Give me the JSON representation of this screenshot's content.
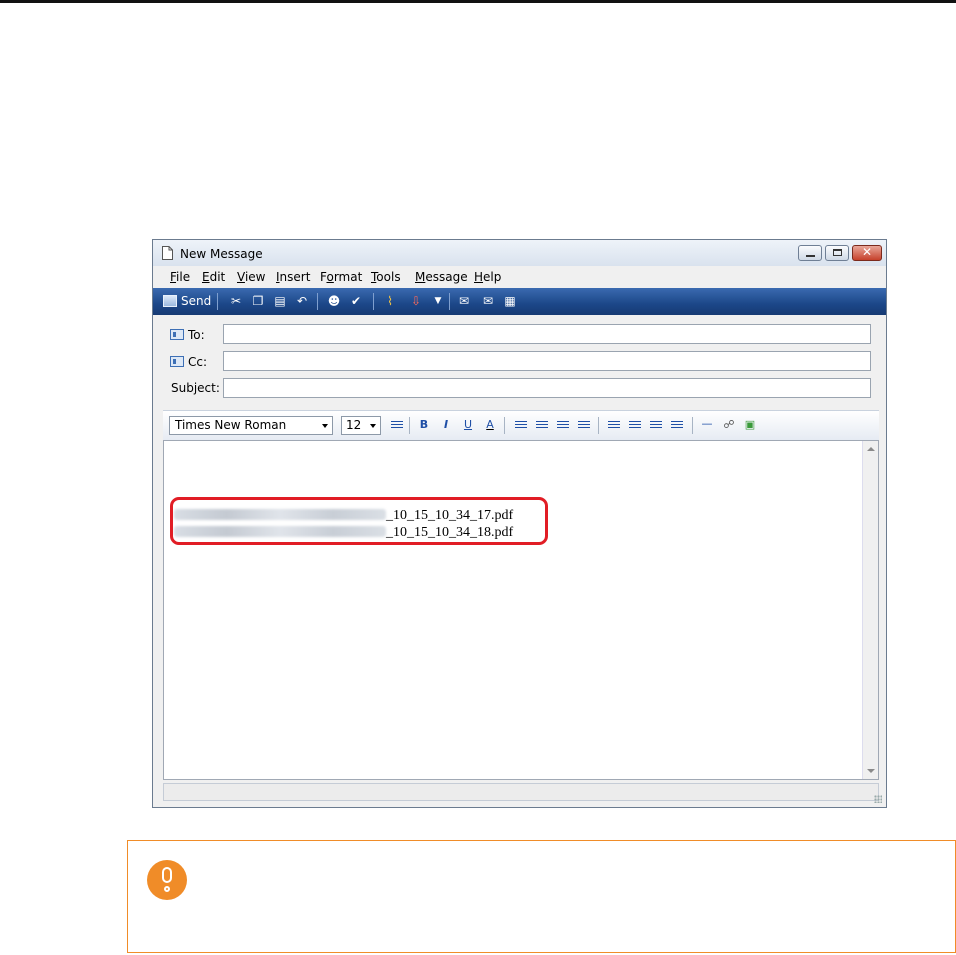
{
  "window": {
    "title": "New Message",
    "menu": [
      {
        "key": "F",
        "rest": "ile"
      },
      {
        "key": "E",
        "rest": "dit"
      },
      {
        "key": "V",
        "rest": "iew"
      },
      {
        "key": "I",
        "rest": "nsert"
      },
      {
        "key": "F",
        "rest": "ormat",
        "underline_index": 1
      },
      {
        "key": "T",
        "rest": "ools"
      },
      {
        "key": "M",
        "rest": "essage"
      },
      {
        "key": "H",
        "rest": "elp"
      }
    ]
  },
  "toolbar": {
    "send_label": "Send"
  },
  "headers": {
    "to_label": "To:",
    "cc_label": "Cc:",
    "subject_label": "Subject:",
    "to_value": "",
    "cc_value": "",
    "subject_value": ""
  },
  "format_bar": {
    "font": "Times New Roman",
    "size": "12",
    "bold": "B",
    "italic": "I",
    "underline": "U",
    "font_color": "A"
  },
  "message_body": {
    "attachments": [
      "_10_15_10_34_17.pdf",
      "_10_15_10_34_18.pdf"
    ]
  },
  "colors": {
    "highlight_border": "#e11d25",
    "note_accent": "#f08c28",
    "toolbar_blue": "#1c4788"
  },
  "icons": {
    "note": "attention-icon"
  }
}
